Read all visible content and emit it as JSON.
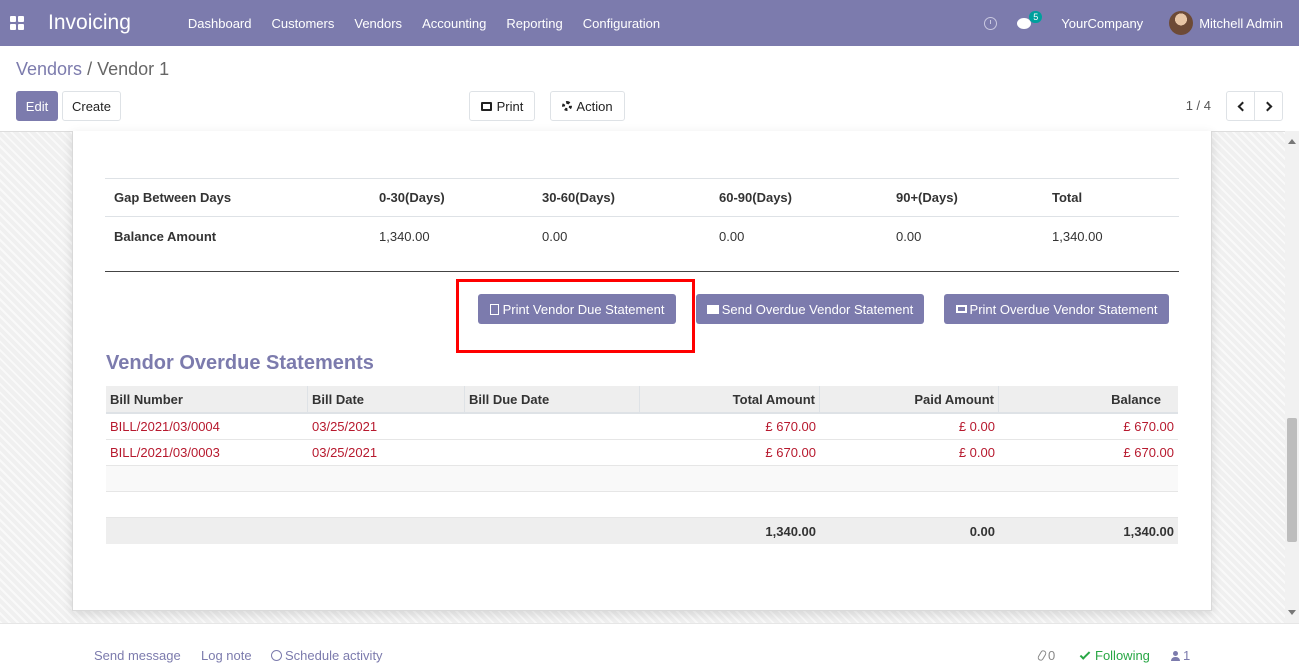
{
  "navbar": {
    "app_title": "Invoicing",
    "menu": [
      "Dashboard",
      "Customers",
      "Vendors",
      "Accounting",
      "Reporting",
      "Configuration"
    ],
    "messages_count": "5",
    "company": "YourCompany",
    "user": "Mitchell Admin"
  },
  "breadcrumb": {
    "parent": "Vendors",
    "separator": "/",
    "current": "Vendor 1"
  },
  "toolbar": {
    "edit_label": "Edit",
    "create_label": "Create",
    "print_label": "Print",
    "action_label": "Action",
    "pager": "1 / 4"
  },
  "ageing": {
    "headers": [
      "Gap Between Days",
      "0-30(Days)",
      "30-60(Days)",
      "60-90(Days)",
      "90+(Days)",
      "Total"
    ],
    "row": [
      "Balance Amount",
      "1,340.00",
      "0.00",
      "0.00",
      "0.00",
      "1,340.00"
    ]
  },
  "actions": {
    "print_due": "Print Vendor Due Statement",
    "send_overdue": "Send Overdue Vendor Statement",
    "print_overdue": "Print Overdue Vendor Statement"
  },
  "overdue": {
    "title": "Vendor Overdue Statements",
    "headers": [
      "Bill Number",
      "Bill Date",
      "Bill Due Date",
      "Total Amount",
      "Paid Amount",
      "Balance"
    ],
    "rows": [
      [
        "BILL/2021/03/0004",
        "03/25/2021",
        "",
        "£ 670.00",
        "£ 0.00",
        "£ 670.00"
      ],
      [
        "BILL/2021/03/0003",
        "03/25/2021",
        "",
        "£ 670.00",
        "£ 0.00",
        "£ 670.00"
      ]
    ],
    "totals": [
      "",
      "",
      "",
      "1,340.00",
      "0.00",
      "1,340.00"
    ]
  },
  "chatter": {
    "send_message": "Send message",
    "log_note": "Log note",
    "schedule_activity": "Schedule activity",
    "attachments": "0",
    "following": "Following",
    "followers": "1"
  },
  "colors": {
    "brand": "#7c7bad",
    "overdue_text": "#b7192e",
    "highlight": "#ff0000"
  }
}
